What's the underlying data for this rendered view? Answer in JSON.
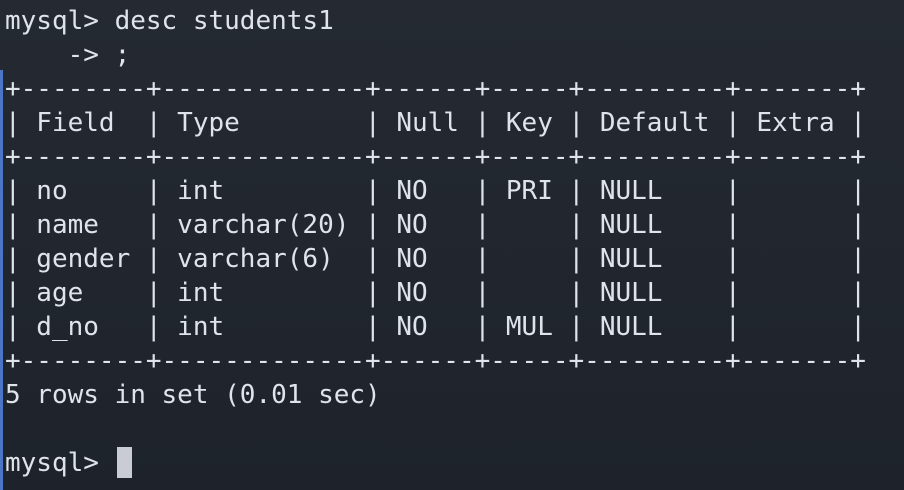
{
  "terminal": {
    "lines": [
      "mysql> desc students1",
      "    -> ;",
      "+--------+-------------+------+-----+---------+-------+",
      "| Field  | Type        | Null | Key | Default | Extra |",
      "+--------+-------------+------+-----+---------+-------+",
      "| no     | int         | NO   | PRI | NULL    |       |",
      "| name   | varchar(20) | NO   |     | NULL    |       |",
      "| gender | varchar(6)  | NO   |     | NULL    |       |",
      "| age    | int         | NO   |     | NULL    |       |",
      "| d_no   | int         | NO   | MUL | NULL    |       |",
      "+--------+-------------+------+-----+---------+-------+",
      "5 rows in set (0.01 sec)",
      "",
      "mysql> "
    ],
    "colors": {
      "background": "#20252d",
      "text": "#dfe3ea",
      "cursor": "#c9ccd2",
      "accent": "#4b76c6"
    }
  }
}
